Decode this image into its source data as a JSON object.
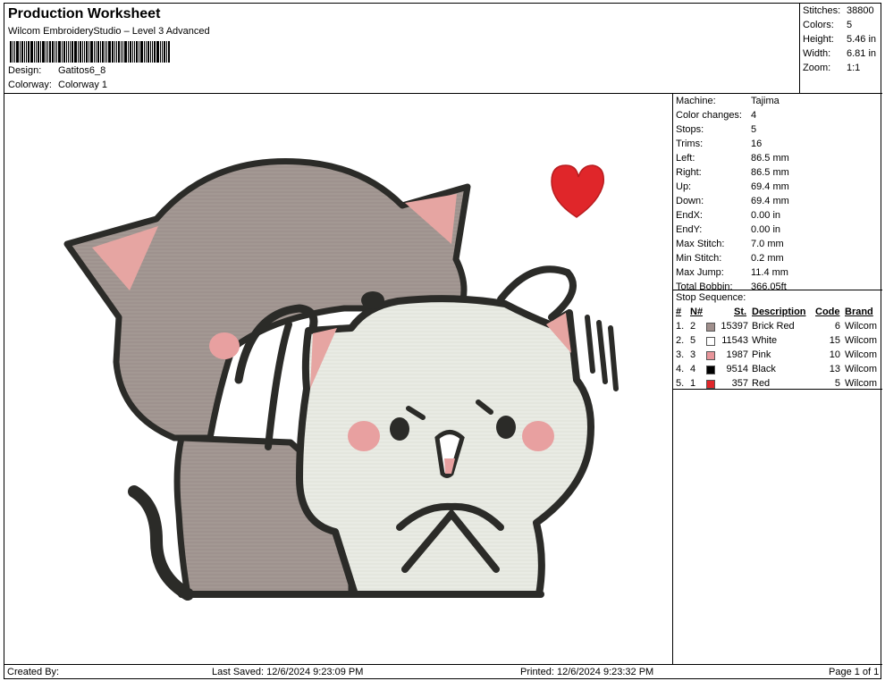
{
  "header": {
    "title": "Production Worksheet",
    "subtitle": "Wilcom EmbroideryStudio – Level 3 Advanced",
    "design_label": "Design:",
    "design_value": "Gatitos6_8",
    "colorway_label": "Colorway:",
    "colorway_value": "Colorway 1"
  },
  "stats": [
    {
      "label": "Stitches:",
      "value": "38800"
    },
    {
      "label": "Colors:",
      "value": "5"
    },
    {
      "label": "Height:",
      "value": "5.46 in"
    },
    {
      "label": "Width:",
      "value": "6.81 in"
    },
    {
      "label": "Zoom:",
      "value": "1:1"
    }
  ],
  "machine": [
    {
      "label": "Machine:",
      "value": "Tajima"
    },
    {
      "label": "Color changes:",
      "value": "4"
    },
    {
      "label": "Stops:",
      "value": "5"
    },
    {
      "label": "Trims:",
      "value": "16"
    },
    {
      "label": "Left:",
      "value": "86.5 mm"
    },
    {
      "label": "Right:",
      "value": "86.5 mm"
    },
    {
      "label": "Up:",
      "value": "69.4 mm"
    },
    {
      "label": "Down:",
      "value": "69.4 mm"
    },
    {
      "label": "EndX:",
      "value": "0.00 in"
    },
    {
      "label": "EndY:",
      "value": "0.00 in"
    },
    {
      "label": "Max Stitch:",
      "value": "7.0 mm"
    },
    {
      "label": "Min Stitch:",
      "value": "0.2 mm"
    },
    {
      "label": "Max Jump:",
      "value": "11.4 mm"
    },
    {
      "label": "Total Bobbin:",
      "value": "366.05ft"
    }
  ],
  "sequence": {
    "title": "Stop Sequence:",
    "columns": [
      "#",
      "N#",
      "St.",
      "Description",
      "Code",
      "Brand"
    ],
    "rows": [
      {
        "num": "1.",
        "n": "2",
        "color": "#a08f8c",
        "st": "15397",
        "desc": "Brick Red",
        "code": "6",
        "brand": "Wilcom"
      },
      {
        "num": "2.",
        "n": "5",
        "color": "#ffffff",
        "st": "11543",
        "desc": "White",
        "code": "15",
        "brand": "Wilcom"
      },
      {
        "num": "3.",
        "n": "3",
        "color": "#e8959a",
        "st": "1987",
        "desc": "Pink",
        "code": "10",
        "brand": "Wilcom"
      },
      {
        "num": "4.",
        "n": "4",
        "color": "#000000",
        "st": "9514",
        "desc": "Black",
        "code": "13",
        "brand": "Wilcom"
      },
      {
        "num": "5.",
        "n": "1",
        "color": "#e0262a",
        "st": "357",
        "desc": "Red",
        "code": "5",
        "brand": "Wilcom"
      }
    ]
  },
  "footer": {
    "created": "Created By:",
    "last_saved": "Last Saved: 12/6/2024 9:23:09 PM",
    "printed": "Printed: 12/6/2024 9:23:32 PM",
    "page": "Page 1 of 1"
  },
  "colors": {
    "gray_cat": "#a39893",
    "white_cat": "#e9ebe4",
    "outline": "#2b2b28",
    "pink": "#e8a0a0",
    "heart": "#e0262a"
  }
}
